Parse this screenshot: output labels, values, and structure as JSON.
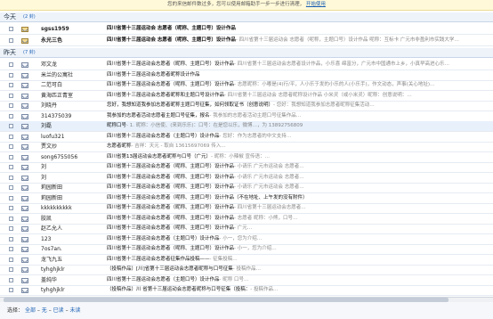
{
  "notice": {
    "text": "您的来信邮件数过多，您可以使用邮箱助手一步一步进行清理，",
    "link": "开始使用"
  },
  "today": {
    "title": "今天",
    "count": "(2 封)"
  },
  "yesterday": {
    "title": "昨天",
    "count": "(7 封)"
  },
  "today_rows": [
    {
      "sender": "sgss1959",
      "subject": "四川省第十三届运动会 志愿者（呢称、主题口号）设计作品",
      "preview": "",
      "unread": true
    },
    {
      "sender": "永光三色",
      "subject": "四川省第十三届运动会 志愿者（呢称、主题口号）设计作品",
      "preview": "- 四川省第十三届运动会 志愿者（呢称，主题口号）设计作品 呢称：互标卡 广元市非盈利市实践大学…",
      "unread": true
    }
  ],
  "yesterday_rows": [
    {
      "sender": "邓文龙",
      "subject": "四川省第十三届运动会志愿者（昵称、主题口号）设计作品",
      "preview": "- 四川省第十三届运动会志愿者设计作品，小乐喜 绵富分，广元市中国通市上乡，小真早高进心乐…",
      "unread": false
    },
    {
      "sender": "米兰的公寓社",
      "subject": "四川省第十三届运动会志愿者昵称设计作品",
      "preview": "",
      "unread": false
    },
    {
      "sender": "二范可白",
      "subject": "四川省第十三届运动会志愿者（呢称、主题口号）设计作品",
      "preview": "- 志愿昵称：小嘟是(4)行/平，人小乐于发的小乐的人(小乐手)，作文动态，声事(关心地址)…",
      "unread": false
    },
    {
      "sender": "黄海匹正青室",
      "subject": "四川省第十三届运动会志愿者昵称和主题口号设计作品",
      "preview": "- 四川省第十三届运动会 志愿者昵称设计作品 小米灵（或小米灵）昵称：创意说明：…",
      "unread": false
    },
    {
      "sender": "刘晓丹",
      "subject": "您好，我想知道我参加志愿者昵称主题口号征集，如何领取证书（创意说明）",
      "preview": "- 您好：我想知道我参加志愿者昵称征集活动…",
      "unread": false
    },
    {
      "sender": "314375039",
      "subject": "我参加的志愿者活动志愿者主题口号征集，报名",
      "preview": "- 我参加的志愿者活动主题口号征集作品…",
      "unread": false
    },
    {
      "sender": "刘磊",
      "subject": "昵称口号",
      "preview": "- 1. 昵称：小信使、(来到乐乐)：口号：在是您以乐，微博…，为 13892756809",
      "unread": false,
      "selected": true
    },
    {
      "sender": "luofu321",
      "subject": "四川省第十三届运动会志愿者（主题口号）设计作品",
      "preview": "- 您好：作为志愿者的中文支持…",
      "unread": false
    },
    {
      "sender": "贾文炒",
      "subject": "志愿者昵称",
      "preview": "- 吉祥：天元 - 取自 13615697069 传入…",
      "unread": false
    },
    {
      "sender": "song6755056",
      "subject": "四川省第13届运动会志愿者昵称与口号（广元）",
      "preview": "- 昵称：小辣椒 宣传语：…",
      "unread": false
    },
    {
      "sender": "刘",
      "subject": "四川省第十三届运动会志愿者（呢称、主题口号）设计作品",
      "preview": "- 小请乐 广元市运动会 志愿者…",
      "unread": false
    },
    {
      "sender": "刘",
      "subject": "四川省第十三届运动会志愿者（呢称、主题口号）设计作品",
      "preview": "- 小请乐 广元市运动会 志愿者…",
      "unread": false
    },
    {
      "sender": "莉园新田",
      "subject": "四川省第十三届运动会志愿者（呢称、主题口号）设计作品",
      "preview": "- 小请乐 广元市运动会 志愿者…",
      "unread": false
    },
    {
      "sender": "莉园新田",
      "subject": "四川省第十三届运动会志愿者（呢称、主题口号）设计作品（不在地址、上午发的没有附件）",
      "preview": "",
      "unread": false
    },
    {
      "sender": "kkkkkkkkkk",
      "subject": "四川省第十三届运动会志愿者（昵称、主题口号）设计作品",
      "preview": "- 四川省第十三届运动会志愿者…",
      "unread": false
    },
    {
      "sender": "胶凯",
      "subject": "四川省第十三届运动会志愿者（呢称、主题口号）设计作品",
      "preview": "- 志愿者 昵称：小熊，口号…",
      "unread": false
    },
    {
      "sender": "赵乙允人",
      "subject": "四川省第十三届运动会志愿者（呢称、主题口号）设计作品",
      "preview": "- 广元…",
      "unread": false
    },
    {
      "sender": "123",
      "subject": "四川省第十三届运动会志愿者（主题口号）设计作品",
      "preview": "- 小一，您为介绍…",
      "unread": false
    },
    {
      "sender": "7os7an.",
      "subject": "四川省第十三届运动会志愿者（呢称、主题口号）设计作品",
      "preview": "- 小一，您为介绍…",
      "unread": false
    },
    {
      "sender": "龙飞九五",
      "subject": "四川省第十三届运动会志愿者征集作品投稿——",
      "preview": "- 征集投稿…",
      "unread": false
    },
    {
      "sender": "tyhghjklr",
      "subject": "（投稿作品）[川]省第十三届运动会志愿者昵称与口号征集",
      "preview": "- 投稿作品…",
      "unread": false
    },
    {
      "sender": "盖纯华",
      "subject": "四川省第十三届运动会志愿者（主题口号）设计作品",
      "preview": "- 昵称 口号…",
      "unread": false
    },
    {
      "sender": "tyhghjklr",
      "subject": "（投稿作品）川 省第十三届运动会志愿者昵称与口号征集（投稿：",
      "preview": "- 投稿作品…",
      "unread": false
    }
  ],
  "footer": {
    "label": "选择：",
    "options": [
      "全部",
      "无",
      "已读",
      "未读"
    ]
  }
}
